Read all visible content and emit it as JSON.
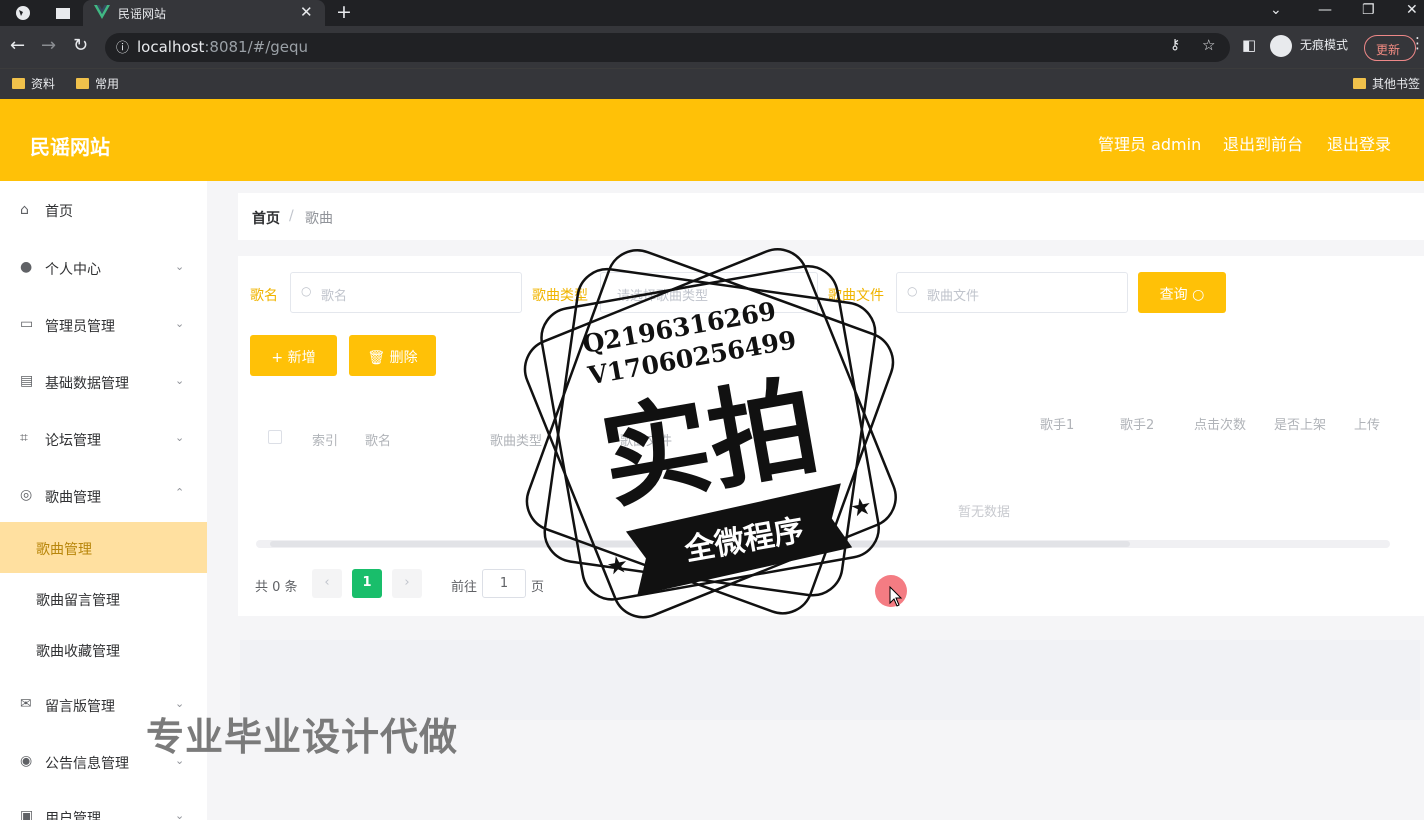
{
  "browser": {
    "tab_title": "民谣网站",
    "url_host": "localhost",
    "url_rest": ":8081/#/gequ",
    "incognito_label": "无痕模式",
    "update_label": "更新",
    "bookmarks": [
      "资料",
      "常用"
    ],
    "other_bookmarks": "其他书签"
  },
  "header": {
    "title": "民谣网站",
    "admin_label": "管理员 admin",
    "to_front": "退出到前台",
    "logout": "退出登录"
  },
  "sidebar": {
    "items": [
      {
        "label": "首页",
        "icon": "home-icon"
      },
      {
        "label": "个人中心",
        "icon": "user-icon"
      },
      {
        "label": "管理员管理",
        "icon": "chat-icon"
      },
      {
        "label": "基础数据管理",
        "icon": "list-icon"
      },
      {
        "label": "论坛管理",
        "icon": "crop-icon"
      },
      {
        "label": "歌曲管理",
        "icon": "compass-icon"
      },
      {
        "label": "留言版管理",
        "icon": "mail-icon"
      },
      {
        "label": "公告信息管理",
        "icon": "target-icon"
      },
      {
        "label": "用户管理",
        "icon": "person-icon"
      }
    ],
    "sub_items": [
      "歌曲管理",
      "歌曲留言管理",
      "歌曲收藏管理"
    ]
  },
  "breadcrumb": {
    "home": "首页",
    "separator": "/",
    "current": "歌曲"
  },
  "search": {
    "name_label": "歌名",
    "name_placeholder": "歌名",
    "type_label": "歌曲类型",
    "type_placeholder": "请选择歌曲类型",
    "file_label": "歌曲文件",
    "file_placeholder": "歌曲文件",
    "query_button": "查询"
  },
  "actions": {
    "add": "+ 新增",
    "delete": "删除"
  },
  "table": {
    "headers": [
      "索引",
      "歌名",
      "歌曲类型",
      "歌曲文件"
    ],
    "right_headers": [
      "歌手1",
      "歌手2",
      "点击次数",
      "是否上架",
      "上传"
    ],
    "empty_text": "暂无数据"
  },
  "pagination": {
    "total": "共 0 条",
    "current_page": "1",
    "goto_prefix": "前往",
    "goto_value": "1",
    "goto_suffix": "页"
  },
  "overlay": {
    "stamp_line1": "Q2196316269",
    "stamp_line2": "V17060256499",
    "stamp_big": "实拍",
    "stamp_ribbon": "全微程序",
    "watermark": "专业毕业设计代做"
  },
  "colors": {
    "accent": "#ffc107",
    "pager_active": "#19be6b"
  }
}
